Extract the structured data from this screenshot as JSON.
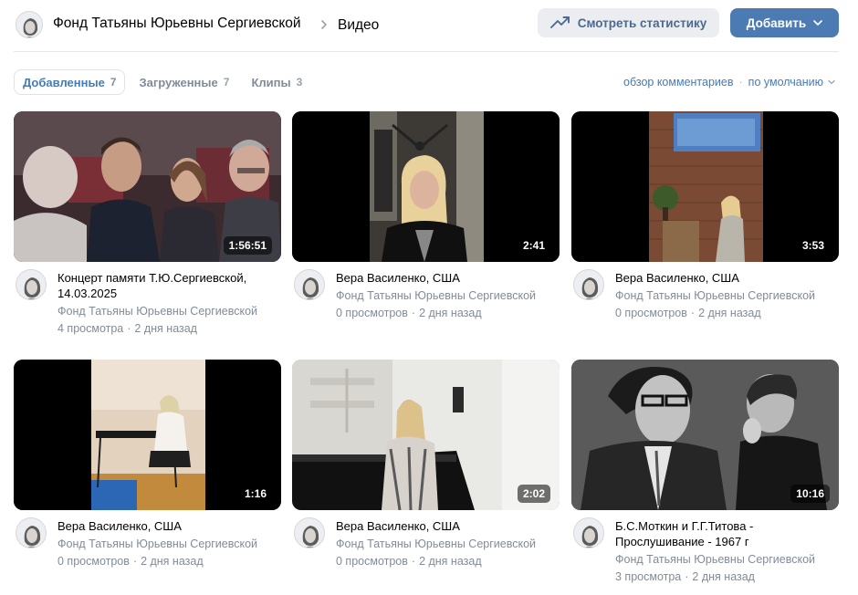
{
  "header": {
    "owner_name": "Фонд Татьяны Юрьевны Сергиевской",
    "page_title": "Видео",
    "stats_button": "Смотреть статистику",
    "add_button": "Добавить",
    "icons": {
      "stats": "trending-up-icon",
      "add": "chevron-down-icon",
      "breadcrumb": "chevron-right-icon"
    }
  },
  "tabs": [
    {
      "label": "Добавленные",
      "count": "7",
      "active": true
    },
    {
      "label": "Загруженные",
      "count": "7",
      "active": false
    },
    {
      "label": "Клипы",
      "count": "3",
      "active": false
    }
  ],
  "sort": {
    "comments_label": "обзор комментариев",
    "order_label": "по умолчанию"
  },
  "colors": {
    "accent": "#4c7ab2",
    "link": "#447bba",
    "secondary_text": "#818c99",
    "button_bg": "#ebedf0"
  },
  "videos": [
    {
      "title": "Концерт памяти Т.Ю.Сергиевской, 14.03.2025",
      "channel": "Фонд Татьяны Юрьевны Сергиевской",
      "views": "4 просмотра",
      "age": "2 дня назад",
      "duration": "1:56:51"
    },
    {
      "title": "Вера Василенко, США",
      "channel": "Фонд Татьяны Юрьевны Сергиевской",
      "views": "0 просмотров",
      "age": "2 дня назад",
      "duration": "2:41"
    },
    {
      "title": "Вера Василенко, США",
      "channel": "Фонд Татьяны Юрьевны Сергиевской",
      "views": "0 просмотров",
      "age": "2 дня назад",
      "duration": "3:53"
    },
    {
      "title": "Вера Василенко, США",
      "channel": "Фонд Татьяны Юрьевны Сергиевской",
      "views": "0 просмотров",
      "age": "2 дня назад",
      "duration": "1:16"
    },
    {
      "title": "Вера Василенко, США",
      "channel": "Фонд Татьяны Юрьевны Сергиевской",
      "views": "0 просмотров",
      "age": "2 дня назад",
      "duration": "2:02"
    },
    {
      "title": "Б.С.Моткин и Г.Г.Титова - Прослушивание - 1967 г",
      "channel": "Фонд Татьяны Юрьевны Сергиевской",
      "views": "3 просмотра",
      "age": "2 дня назад",
      "duration": "10:16"
    }
  ]
}
